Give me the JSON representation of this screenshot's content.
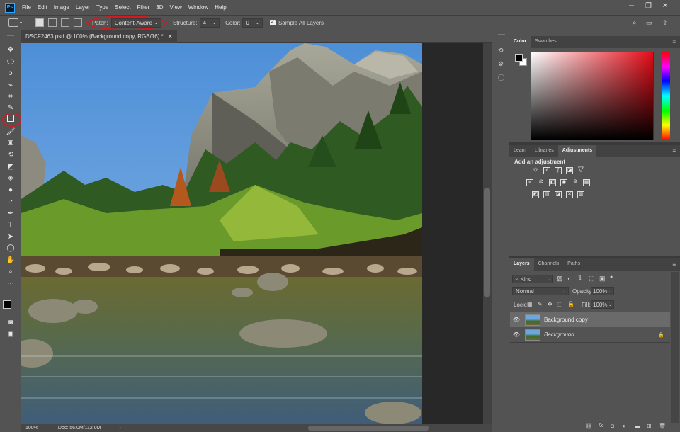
{
  "menubar": {
    "logo": "Ps",
    "items": [
      "File",
      "Edit",
      "Image",
      "Layer",
      "Type",
      "Select",
      "Filter",
      "3D",
      "View",
      "Window",
      "Help"
    ]
  },
  "options": {
    "patch_label": "Patch:",
    "patch_value": "Content-Aware",
    "structure_label": "Structure:",
    "structure_value": "4",
    "color_label": "Color:",
    "color_value": "0",
    "sample_all_label": "Sample All Layers"
  },
  "document": {
    "tab_title": "DSCF2463.psd @ 100% (Background copy, RGB/16) *",
    "zoom": "100%",
    "doc_size": "Doc: 56.0M/112.0M"
  },
  "panels": {
    "color_tabs": [
      "Color",
      "Swatches"
    ],
    "adjust_tabs": [
      "Learn",
      "Libraries",
      "Adjustments"
    ],
    "add_adjustment_label": "Add an adjustment",
    "layers_tabs": [
      "Layers",
      "Channels",
      "Paths"
    ],
    "kind_label": "Kind",
    "blend_mode": "Normal",
    "opacity_label": "Opacity:",
    "opacity_value": "100%",
    "lock_label": "Lock:",
    "fill_label": "Fill:",
    "fill_value": "100%",
    "layers": [
      {
        "name": "Background copy",
        "locked": false,
        "selected": true
      },
      {
        "name": "Background",
        "locked": true,
        "selected": false
      }
    ]
  },
  "colors": {
    "accent_annotation": "#d71820",
    "foreground": "#000000",
    "background": "#ffffff"
  }
}
